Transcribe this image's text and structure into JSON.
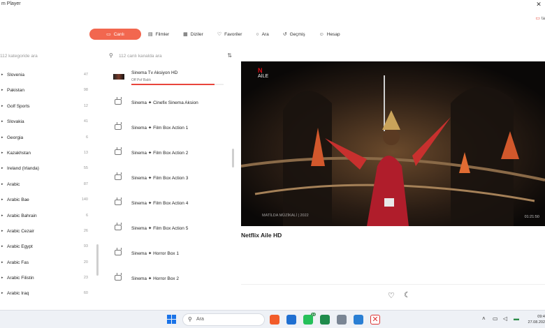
{
  "window": {
    "title": "m Player",
    "close_symbol": "✕"
  },
  "top_right": {
    "label": "ta"
  },
  "nav": [
    {
      "label": "Canlı",
      "icon": "tv-icon",
      "glyph": "▭",
      "active": true
    },
    {
      "label": "Filmler",
      "icon": "film-icon",
      "glyph": "▤"
    },
    {
      "label": "Diziler",
      "icon": "series-icon",
      "glyph": "▦"
    },
    {
      "label": "Favoriler",
      "icon": "heart-icon",
      "glyph": "♡"
    },
    {
      "label": "Ara",
      "icon": "search-icon",
      "glyph": "○"
    },
    {
      "label": "Geçmiş",
      "icon": "history-icon",
      "glyph": "↺"
    },
    {
      "label": "Hesap",
      "icon": "user-icon",
      "glyph": "☺"
    }
  ],
  "categories": {
    "search_placeholder": "112 kategoride ara",
    "items": [
      {
        "name": "Slovenia",
        "count": "47"
      },
      {
        "name": "Pakistan",
        "count": "98"
      },
      {
        "name": "Golf Sports",
        "count": "12"
      },
      {
        "name": "Slovakia",
        "count": "41"
      },
      {
        "name": "Georgia",
        "count": "6"
      },
      {
        "name": "Kazakhstan",
        "count": "13"
      },
      {
        "name": "Ireland (Irlanda)",
        "count": "55"
      },
      {
        "name": "Arabic",
        "count": "87"
      },
      {
        "name": "Arabic Bae",
        "count": "140"
      },
      {
        "name": "Arabic Bahrain",
        "count": "6"
      },
      {
        "name": "Arabic Cezair",
        "count": "26"
      },
      {
        "name": "Arabic Egypt",
        "count": "93"
      },
      {
        "name": "Arabic Fas",
        "count": "20"
      },
      {
        "name": "Arabic Filistin",
        "count": "23"
      },
      {
        "name": "Arabic Iraq",
        "count": "60"
      }
    ]
  },
  "channels": {
    "search_placeholder": "112 canlı kanalda ara",
    "items": [
      {
        "name": "Sinema Tv Aksiyon HD",
        "sub": "Off Pof Balık",
        "active": true,
        "progress": 0.9
      },
      {
        "name": "Sinema ✦ Cinefix Sinema Aksion"
      },
      {
        "name": "Sinema ✦ Film Box Action 1"
      },
      {
        "name": "Sinema ✦ Film Box Action 2"
      },
      {
        "name": "Sinema ✦ Film Box Action 3"
      },
      {
        "name": "Sinema ✦ Film Box Action 4"
      },
      {
        "name": "Sinema ✦ Film Box Action 5"
      },
      {
        "name": "Sinema ✦ Horror Box 1"
      },
      {
        "name": "Sinema ✦ Horror Box 2"
      }
    ]
  },
  "player": {
    "logo_top": "N",
    "logo_bottom": "AİLE",
    "watermark": "MATİLDA MÜZİKALİ | 2022",
    "time": "01:21:50",
    "now_playing": "Netflix Aile HD"
  },
  "taskbar": {
    "search_placeholder": "Ara",
    "badge": "24",
    "clock_time": "09:4",
    "clock_date": "27.08.202"
  }
}
